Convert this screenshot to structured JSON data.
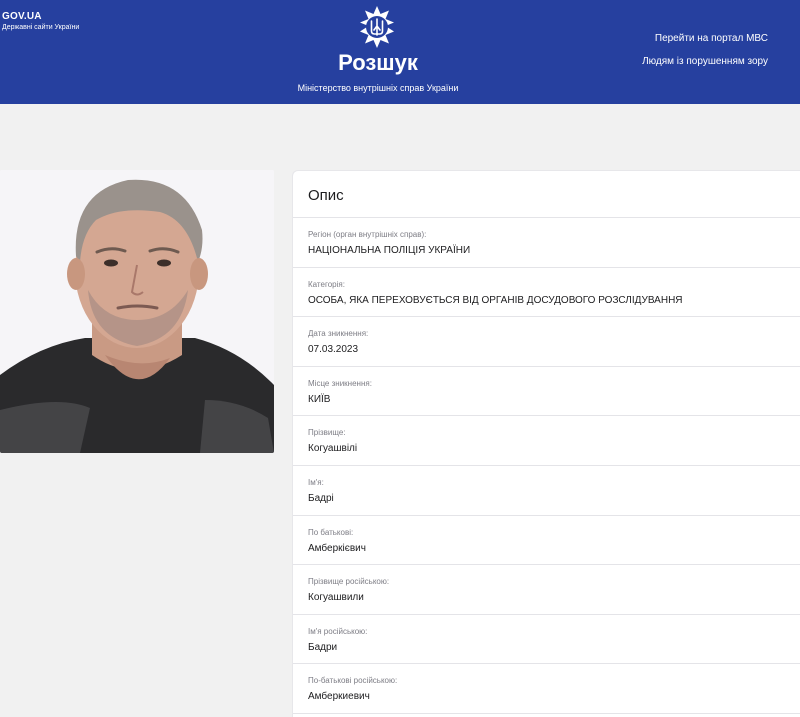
{
  "header": {
    "gov_logo": "GOV.UA",
    "gov_sub": "Державні сайти України",
    "emblem_icon": "trident-icon",
    "title": "Розшук",
    "subtitle": "Міністерство внутрішніх справ України",
    "links": [
      "Перейти на портал МВС",
      "Людям із порушенням зору"
    ]
  },
  "photo": {
    "icon": "person-photo"
  },
  "card": {
    "title": "Опис",
    "fields": [
      {
        "label": "Регіон (орган внутрішніх справ):",
        "value": "НАЦІОНАЛЬНА ПОЛІЦІЯ УКРАЇНИ"
      },
      {
        "label": "Категорія:",
        "value": "ОСОБА, ЯКА ПЕРЕХОВУЄТЬСЯ ВІД ОРГАНІВ ДОСУДОВОГО РОЗСЛІДУВАННЯ"
      },
      {
        "label": "Дата зникнення:",
        "value": "07.03.2023"
      },
      {
        "label": "Місце зникнення:",
        "value": "КИЇВ"
      },
      {
        "label": "Прізвище:",
        "value": "Когуашвілі"
      },
      {
        "label": "Ім'я:",
        "value": "Бадрі"
      },
      {
        "label": "По батькові:",
        "value": "Амберкієвич"
      },
      {
        "label": "Прізвище російською:",
        "value": "Когуашвили"
      },
      {
        "label": "Ім'я російською:",
        "value": "Бадри"
      },
      {
        "label": "По-батькові російською:",
        "value": "Амберкиевич"
      }
    ]
  }
}
